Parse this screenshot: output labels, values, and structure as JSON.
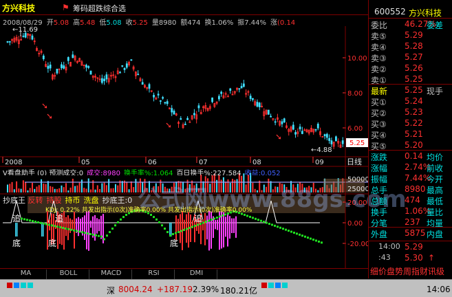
{
  "header": {
    "ticker_title": "方兴科技",
    "formula_title": "筹码超跌综合选",
    "date": "2008/08/29"
  },
  "quote_line": [
    {
      "label": "开",
      "value": "5.08",
      "color": "#ff3030"
    },
    {
      "label": "高",
      "value": "5.48",
      "color": "#ff3030"
    },
    {
      "label": "低",
      "value": "5.08",
      "color": "#00e0e0"
    },
    {
      "label": "收",
      "value": "5.25",
      "color": "#ff3030"
    },
    {
      "label": "量",
      "value": "8980",
      "color": "#c0c0c0"
    },
    {
      "label": "额",
      "value": "474",
      "color": "#c0c0c0"
    },
    {
      "label": "换",
      "value": "1.06%",
      "color": "#c0c0c0"
    },
    {
      "label": "振",
      "value": "7.44%",
      "color": "#c0c0c0"
    },
    {
      "label": "涨",
      "value": "(0.14",
      "color": "#ff3030"
    }
  ],
  "main_chart": {
    "yticks": [
      "10.00",
      "8.00",
      "6.00"
    ],
    "high_label": "11.69",
    "low_label": "4.88",
    "last_price": "5.25",
    "xlabels": [
      "2008",
      "05",
      "06",
      "07",
      "08",
      "09"
    ],
    "period_label": "日线"
  },
  "volume_panel": {
    "title": "V看盘助手 (0)",
    "items": [
      {
        "label": "预测成交:0",
        "color": "#e0e0e0"
      },
      {
        "label": "成交:8980",
        "color": "#ff40ff"
      },
      {
        "label": "换手率%:1.064",
        "color": "#00e000"
      },
      {
        "label": "百日换手%:227.584",
        "color": "#e0e0e0"
      },
      {
        "label": "收益:0.052",
        "color": "#4060ff"
      }
    ],
    "yticks": [
      "50000",
      "25000"
    ]
  },
  "indicator_panel": {
    "title": "抄底王",
    "items": [
      {
        "label": "反转",
        "color": "#ff3030"
      },
      {
        "label": "持股",
        "color": "#ff3030"
      },
      {
        "label": "持币",
        "color": "#ffff00"
      },
      {
        "label": "洗盘",
        "color": "#ffff00"
      },
      {
        "label": "抄底王:0",
        "color": "#e0e0e0"
      }
    ],
    "overlay": "KDJ: 0.22%  共发出指示(0次)准确率0.00%  共发出指示(0次)准确率0.00%",
    "yticks": [
      "20.00",
      "0.00",
      "-20.00"
    ],
    "tags": [
      "追",
      "追",
      "追",
      "底",
      "底",
      "底"
    ]
  },
  "tabs": [
    "MA",
    "BOLL",
    "MACD",
    "RSI",
    "DMI"
  ],
  "right_panel": {
    "code": "600552",
    "name": "方兴科技",
    "weibi": {
      "label": "委比",
      "value": "46.27%",
      "extra": "委差"
    },
    "asks": [
      {
        "label": "卖⑤",
        "value": "5.29"
      },
      {
        "label": "卖④",
        "value": "5.28"
      },
      {
        "label": "卖③",
        "value": "5.27"
      },
      {
        "label": "卖②",
        "value": "5.26"
      },
      {
        "label": "卖①",
        "value": "5.25"
      }
    ],
    "latest": {
      "label": "最新",
      "value": "5.25",
      "extra": "现手"
    },
    "bids": [
      {
        "label": "买①",
        "value": "5.24"
      },
      {
        "label": "买②",
        "value": "5.23"
      },
      {
        "label": "买③",
        "value": "5.22"
      },
      {
        "label": "买④",
        "value": "5.21"
      },
      {
        "label": "买⑤",
        "value": "5.20"
      }
    ],
    "stats": [
      {
        "label": "涨跌",
        "value": "0.14",
        "extra": "均价"
      },
      {
        "label": "涨幅",
        "value": "2.74%",
        "extra": "前收"
      },
      {
        "label": "振幅",
        "value": "7.44%",
        "extra": "今开"
      },
      {
        "label": "总手",
        "value": "8980",
        "extra": "最高"
      },
      {
        "label": "总额",
        "value": "474",
        "extra": "最低"
      },
      {
        "label": "换手",
        "value": "1.06%",
        "extra": "量比"
      },
      {
        "label": "分笔",
        "value": "237",
        "extra": "均量"
      }
    ],
    "waipan": {
      "label": "外盘",
      "value": "5875",
      "extra": "内盘"
    },
    "ticks": [
      {
        "time": "14:00",
        "price": "5.29"
      },
      {
        "time": ":43",
        "price": "5.30",
        "arrow": "↑"
      }
    ],
    "bottom_tabs": "细价盘势周指财讯级"
  },
  "statusbar": {
    "index_name": "深",
    "index_value": "8004.24",
    "change": "+187.19",
    "pct": "2.39%",
    "amount": "180.21亿",
    "time": "14:06"
  },
  "watermark": "公式网www.88gs.com"
}
